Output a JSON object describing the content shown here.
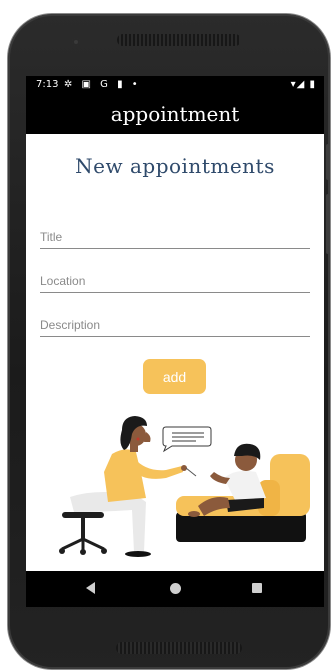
{
  "status_bar": {
    "time": "7:13",
    "left_icons": "✲ ▣ G ▮ •",
    "right_icons": "▾◢ ▮"
  },
  "app_bar": {
    "title": "appointment"
  },
  "form": {
    "heading": "New appointments",
    "title_placeholder": "Title",
    "location_placeholder": "Location",
    "description_placeholder": "Description",
    "title_value": "",
    "location_value": "",
    "description_value": "",
    "add_label": "add"
  },
  "colors": {
    "accent": "#f6c25a",
    "heading": "#2f4a6b",
    "bars": "#000000"
  },
  "icons": {
    "nav_back": "back-triangle-icon",
    "nav_home": "home-circle-icon",
    "nav_recents": "recents-square-icon"
  }
}
